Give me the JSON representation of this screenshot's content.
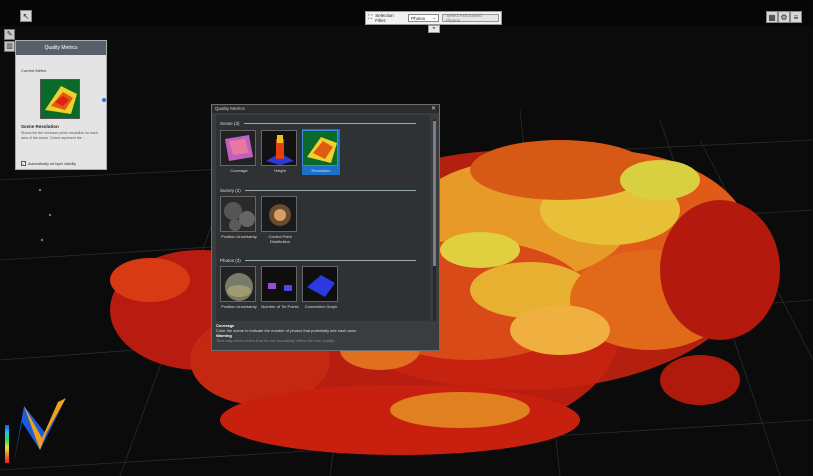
{
  "toolbar": {
    "left_button_icon": "cursor-icon",
    "right_buttons": [
      "grid-icon",
      "settings-icon",
      "layers-icon"
    ]
  },
  "filter": {
    "label": "Selection Filter:",
    "value": "Photos",
    "button_label": "Select Associated Photos"
  },
  "side_tools": [
    "brush-icon",
    "chart-icon"
  ],
  "small_panel": {
    "title": "Quality Metrics",
    "current_metric_label": "Current Metric",
    "metric_title": "Scene Resolution",
    "metric_description": "Shows the the minimum photo resolution for each area of the scene. Colors represent the ...",
    "checkbox_label": "Automatically set layer visibility",
    "checked": true
  },
  "dialog": {
    "title": "Quality Metrics",
    "sections": [
      {
        "title": "Scene (3)",
        "items": [
          {
            "label": "Coverage",
            "selected": false
          },
          {
            "label": "Height",
            "selected": false
          },
          {
            "label": "Resolution",
            "selected": true
          }
        ]
      },
      {
        "title": "Survey (2)",
        "items": [
          {
            "label": "Position Uncertainty",
            "selected": false
          },
          {
            "label": "Control Point Distribution",
            "selected": false
          }
        ]
      },
      {
        "title": "Photos (3)",
        "items": [
          {
            "label": "Position Uncertainty",
            "selected": false
          },
          {
            "label": "Number of Tie Points",
            "selected": false
          },
          {
            "label": "Connection Graph",
            "selected": false
          }
        ]
      }
    ],
    "description_title": "Coverage",
    "description_text": "Color the scene to indicate the number of photos that potentially see each area.",
    "warning_title": "Warning",
    "warning_text": "Tiles may show colors that do not accurately reflect the true quality..."
  },
  "colors": {
    "dialog_bg": "#3a3d40",
    "selected": "#1e6fc8",
    "cloud_hot": "#e82818",
    "cloud_mid": "#f07a20",
    "cloud_warm": "#f0c030"
  }
}
